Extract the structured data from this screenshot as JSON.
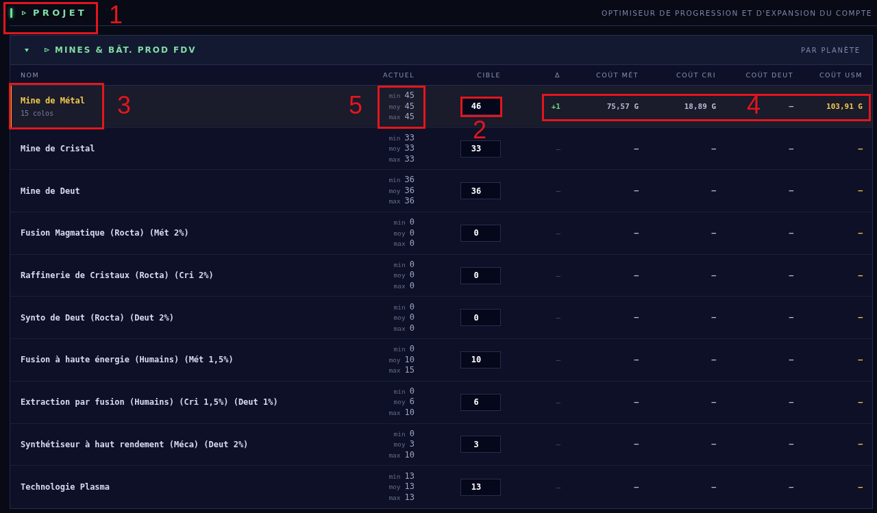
{
  "header": {
    "title": "PROJET",
    "subtitle": "OPTIMISEUR DE PROGRESSION ET D'EXPANSION DU COMPTE",
    "callout": "1"
  },
  "section": {
    "title": "MINES & BÂT. PROD FDV",
    "expanded": true,
    "scope": "PAR PLANÈTE"
  },
  "table": {
    "columns": [
      "NOM",
      "ACTUEL",
      "CIBLE",
      "Δ",
      "COÛT MÉT",
      "COÛT CRI",
      "COÛT DEUT",
      "COÛT USM"
    ],
    "rows": [
      {
        "name": "Mine de Métal",
        "note": "15 colos",
        "selected": true,
        "current": [
          {
            "label": "min",
            "value": "45"
          },
          {
            "label": "moy",
            "value": "45"
          },
          {
            "label": "max",
            "value": "45"
          }
        ],
        "target": "46",
        "delta": {
          "text": "+1",
          "kind": "increase"
        },
        "costs": [
          "75,57 G",
          "18,89 G",
          "—",
          "103,91 G"
        ],
        "callouts": {
          "name": "3",
          "current": "5",
          "target": "2",
          "costs": "4"
        }
      },
      {
        "name": "Mine de Cristal",
        "selected": false,
        "current": [
          {
            "label": "min",
            "value": "33"
          },
          {
            "label": "moy",
            "value": "33"
          },
          {
            "label": "max",
            "value": "33"
          }
        ],
        "target": "33",
        "delta": {
          "text": "—",
          "kind": "none"
        },
        "costs": [
          "—",
          "—",
          "—",
          "—"
        ]
      },
      {
        "name": "Mine de Deut",
        "selected": false,
        "current": [
          {
            "label": "min",
            "value": "36"
          },
          {
            "label": "moy",
            "value": "36"
          },
          {
            "label": "max",
            "value": "36"
          }
        ],
        "target": "36",
        "delta": {
          "text": "—",
          "kind": "none"
        },
        "costs": [
          "—",
          "—",
          "—",
          "—"
        ]
      },
      {
        "name": "Fusion Magmatique (Rocta) (Mét 2%)",
        "selected": false,
        "current": [
          {
            "label": "min",
            "value": "0"
          },
          {
            "label": "moy",
            "value": "0"
          },
          {
            "label": "max",
            "value": "0"
          }
        ],
        "target": "0",
        "delta": {
          "text": "—",
          "kind": "none"
        },
        "costs": [
          "—",
          "—",
          "—",
          "—"
        ]
      },
      {
        "name": "Raffinerie de Cristaux (Rocta) (Cri 2%)",
        "selected": false,
        "current": [
          {
            "label": "min",
            "value": "0"
          },
          {
            "label": "moy",
            "value": "0"
          },
          {
            "label": "max",
            "value": "0"
          }
        ],
        "target": "0",
        "delta": {
          "text": "—",
          "kind": "none"
        },
        "costs": [
          "—",
          "—",
          "—",
          "—"
        ]
      },
      {
        "name": "Synto de Deut (Rocta) (Deut 2%)",
        "selected": false,
        "current": [
          {
            "label": "min",
            "value": "0"
          },
          {
            "label": "moy",
            "value": "0"
          },
          {
            "label": "max",
            "value": "0"
          }
        ],
        "target": "0",
        "delta": {
          "text": "—",
          "kind": "none"
        },
        "costs": [
          "—",
          "—",
          "—",
          "—"
        ]
      },
      {
        "name": "Fusion à haute énergie (Humains) (Mét 1,5%)",
        "selected": false,
        "current": [
          {
            "label": "min",
            "value": "0"
          },
          {
            "label": "moy",
            "value": "10"
          },
          {
            "label": "max",
            "value": "15"
          }
        ],
        "target": "10",
        "delta": {
          "text": "—",
          "kind": "none"
        },
        "costs": [
          "—",
          "—",
          "—",
          "—"
        ]
      },
      {
        "name": "Extraction par fusion (Humains) (Cri 1,5%) (Deut 1%)",
        "selected": false,
        "current": [
          {
            "label": "min",
            "value": "0"
          },
          {
            "label": "moy",
            "value": "6"
          },
          {
            "label": "max",
            "value": "10"
          }
        ],
        "target": "6",
        "delta": {
          "text": "—",
          "kind": "none"
        },
        "costs": [
          "—",
          "—",
          "—",
          "—"
        ]
      },
      {
        "name": "Synthétiseur à haut rendement (Méca) (Deut 2%)",
        "selected": false,
        "current": [
          {
            "label": "min",
            "value": "0"
          },
          {
            "label": "moy",
            "value": "3"
          },
          {
            "label": "max",
            "value": "10"
          }
        ],
        "target": "3",
        "delta": {
          "text": "—",
          "kind": "none"
        },
        "costs": [
          "—",
          "—",
          "—",
          "—"
        ]
      },
      {
        "name": "Technologie Plasma",
        "selected": false,
        "current": [
          {
            "label": "min",
            "value": "13"
          },
          {
            "label": "moy",
            "value": "13"
          },
          {
            "label": "max",
            "value": "13"
          }
        ],
        "target": "13",
        "delta": {
          "text": "—",
          "kind": "none"
        },
        "costs": [
          "—",
          "—",
          "—",
          "—"
        ]
      }
    ]
  }
}
